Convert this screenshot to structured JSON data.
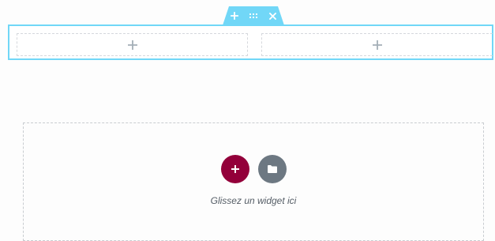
{
  "section_handle": {
    "add_icon": "plus-icon",
    "move_icon": "grip-icon",
    "delete_icon": "close-icon",
    "color": "#71d7f7"
  },
  "section": {
    "border_color": "#71d7f7",
    "columns": [
      {
        "icon": "plus-icon"
      },
      {
        "icon": "plus-icon"
      }
    ]
  },
  "drop_area": {
    "add_icon": "plus-icon",
    "template_icon": "folder-icon",
    "add_color": "#93003a",
    "template_color": "#6d7882",
    "hint": "Glissez un widget ici"
  }
}
